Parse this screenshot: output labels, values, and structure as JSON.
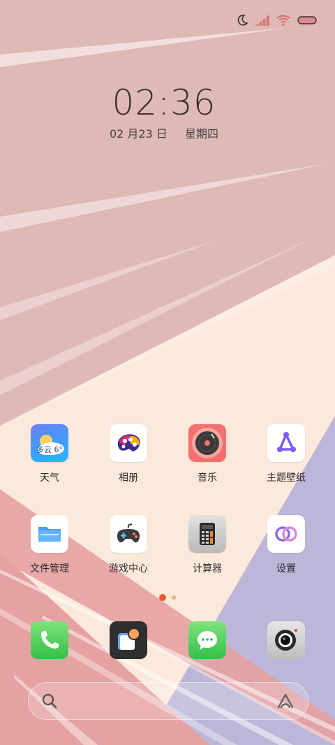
{
  "status_bar": {
    "icons": [
      "moon-icon",
      "cellular-signal-icon",
      "wifi-icon",
      "battery-icon"
    ],
    "accent": "#d9696b"
  },
  "lockclock": {
    "time": "02:36",
    "date": "02 月23 日",
    "weekday": "星期四"
  },
  "apps": [
    {
      "label": "天气",
      "icon": "weather-icon",
      "badge_text": "多云 6°"
    },
    {
      "label": "相册",
      "icon": "gallery-icon"
    },
    {
      "label": "音乐",
      "icon": "music-icon"
    },
    {
      "label": "主题壁纸",
      "icon": "themes-icon"
    },
    {
      "label": "文件管理",
      "icon": "file-manager-icon"
    },
    {
      "label": "游戏中心",
      "icon": "game-center-icon"
    },
    {
      "label": "计算器",
      "icon": "calculator-icon"
    },
    {
      "label": "设置",
      "icon": "settings-icon"
    }
  ],
  "page_indicator": {
    "count": 2,
    "active": 1,
    "active_color": "#f05a28"
  },
  "dock": [
    {
      "icon": "phone-icon"
    },
    {
      "icon": "app-store-icon"
    },
    {
      "icon": "messages-icon"
    },
    {
      "icon": "camera-icon"
    }
  ],
  "search": {
    "icon": "search-icon",
    "assistant_icon": "assistant-icon"
  },
  "colors": {
    "wallpaper_pink": "#dfb9b6",
    "wallpaper_cream": "#fbe9dc",
    "wallpaper_lavender": "#bdb6d8",
    "wallpaper_rose": "#e6a1a2"
  }
}
